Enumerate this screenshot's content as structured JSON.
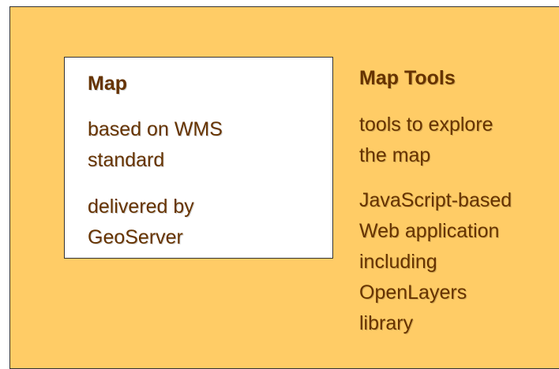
{
  "map_box": {
    "title": "Map",
    "item1_line1": "based on WMS",
    "item1_line2": "standard",
    "item2_line1": "delivered by",
    "item2_line2": "GeoServer"
  },
  "tools": {
    "title": "Map Tools",
    "item1_line1": "tools to explore",
    "item1_line2": "the map",
    "item2_line1": "JavaScript-based",
    "item2_line2": "Web application",
    "item2_line3": "including",
    "item2_line4": "OpenLayers",
    "item2_line5": "library"
  },
  "colors": {
    "background": "#FFCC66",
    "text": "#663300",
    "box": "#FFFFFF"
  }
}
